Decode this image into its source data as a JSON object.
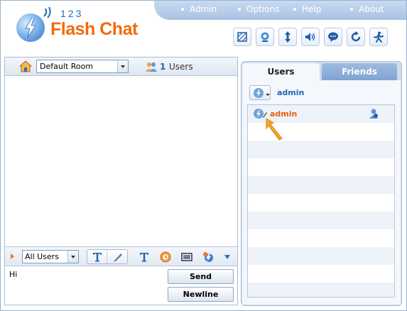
{
  "app": {
    "logo_number": "123",
    "logo_text": "Flash Chat",
    "colors": {
      "brand_orange": "#f26a0c",
      "brand_blue": "#1e6fc0",
      "menu_bar": "#b7cde9"
    }
  },
  "menu": {
    "items": [
      {
        "label": "Admin"
      },
      {
        "label": "Options"
      },
      {
        "label": "Help"
      },
      {
        "label": "About"
      }
    ]
  },
  "toolbar": {
    "icons": [
      "skin-icon",
      "webcam-icon",
      "resize-icon",
      "sound-icon",
      "bubble-icon",
      "refresh-icon",
      "logout-icon"
    ]
  },
  "room": {
    "selected": "Default Room",
    "user_count": "1",
    "users_label": "Users"
  },
  "compose": {
    "recipient": "All Users",
    "message": "Hi",
    "send_label": "Send",
    "newline_label": "Newline"
  },
  "sidebar": {
    "tabs": [
      {
        "label": "Users",
        "active": true
      },
      {
        "label": "Friends",
        "active": false
      }
    ],
    "current_user": "admin",
    "users": [
      {
        "name": "admin"
      }
    ]
  }
}
